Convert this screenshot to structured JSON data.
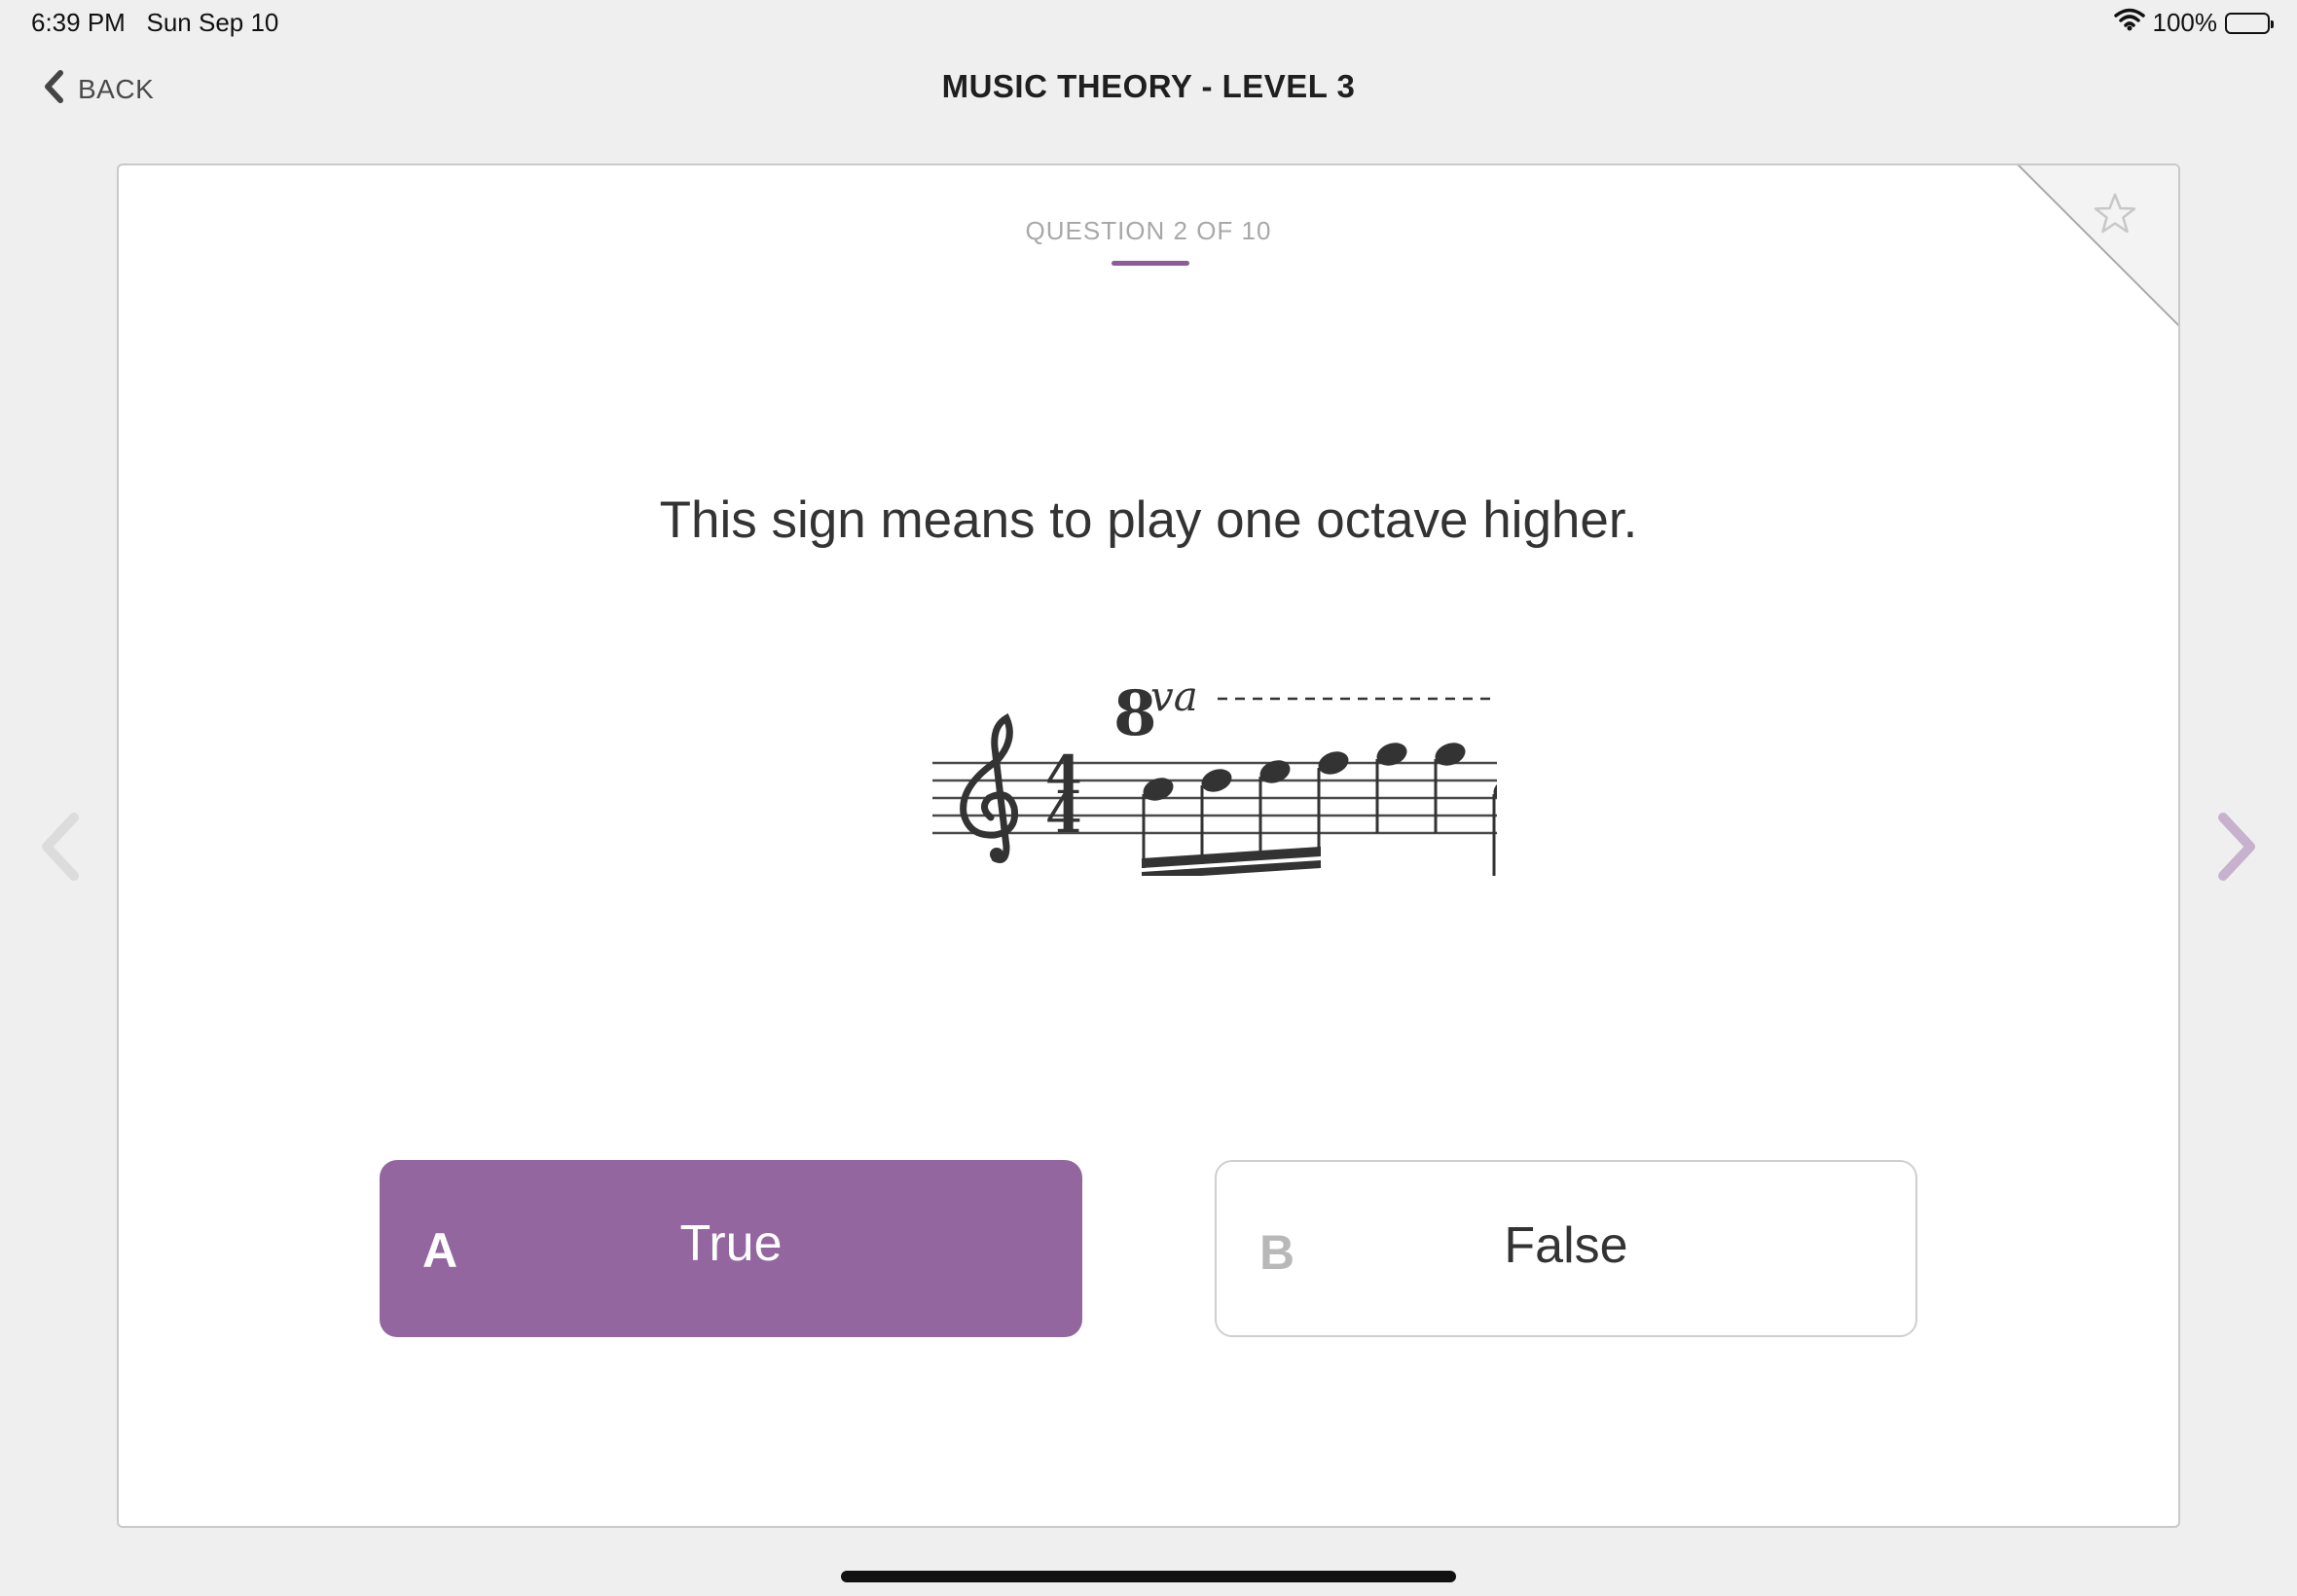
{
  "status": {
    "time": "6:39 PM",
    "date": "Sun Sep 10",
    "battery_text": "100%"
  },
  "nav": {
    "back_label": "BACK",
    "title": "MUSIC THEORY - LEVEL 3"
  },
  "question": {
    "counter": "QUESTION 2 OF 10",
    "prompt": "This sign means to play one octave higher.",
    "notation": {
      "octave_sign_number": "8",
      "octave_sign_suffix": "va",
      "time_signature": "4/4"
    }
  },
  "answers": [
    {
      "letter": "A",
      "text": "True",
      "selected": true
    },
    {
      "letter": "B",
      "text": "False",
      "selected": false
    }
  ],
  "colors": {
    "accent": "#93669f",
    "background": "#efefef",
    "card": "#ffffff"
  },
  "icons": [
    "chevron-left-icon",
    "wifi-icon",
    "battery-icon",
    "star-icon",
    "arrow-left-icon",
    "arrow-right-icon"
  ]
}
